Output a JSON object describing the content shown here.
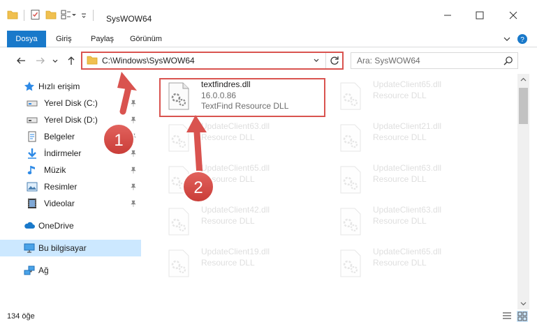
{
  "window": {
    "title": "SysWOW64"
  },
  "ribbon": {
    "tabs": [
      {
        "label": "Dosya"
      },
      {
        "label": "Giriş"
      },
      {
        "label": "Paylaş"
      },
      {
        "label": "Görünüm"
      }
    ]
  },
  "address": {
    "path": "C:\\Windows\\SysWOW64"
  },
  "search": {
    "placeholder": "Ara: SysWOW64"
  },
  "navigation": {
    "quick_access": "Hızlı erişim",
    "items": [
      {
        "label": "Yerel Disk (C:)",
        "icon": "drive-icon"
      },
      {
        "label": "Yerel Disk (D:)",
        "icon": "drive-icon"
      },
      {
        "label": "Belgeler",
        "icon": "documents-icon"
      },
      {
        "label": "İndirmeler",
        "icon": "downloads-icon"
      },
      {
        "label": "Müzik",
        "icon": "music-icon"
      },
      {
        "label": "Resimler",
        "icon": "pictures-icon"
      },
      {
        "label": "Videolar",
        "icon": "videos-icon"
      }
    ],
    "onedrive": "OneDrive",
    "this_pc": "Bu bilgisayar",
    "network": "Ağ"
  },
  "files": [
    {
      "name": "textfindres.dll",
      "version": "16.0.0.86",
      "description": "TextFind Resource DLL",
      "state": "active"
    },
    {
      "name": "UpdateClient65.dll",
      "description": "Resource DLL",
      "state": "faded"
    },
    {
      "name": "UpdateClient63.dll",
      "description": "Resource DLL",
      "state": "faded"
    },
    {
      "name": "UpdateClient21.dll",
      "description": "Resource DLL",
      "state": "faded"
    },
    {
      "name": "UpdateClient65.dll",
      "description": "Resource DLL",
      "state": "faded"
    },
    {
      "name": "UpdateClient63.dll",
      "description": "Resource DLL",
      "state": "faded"
    },
    {
      "name": "UpdateClient42.dll",
      "description": "Resource DLL",
      "state": "faded"
    },
    {
      "name": "UpdateClient63.dll",
      "description": "Resource DLL",
      "state": "faded"
    },
    {
      "name": "UpdateClient19.dll",
      "description": "Resource DLL",
      "state": "faded"
    },
    {
      "name": "UpdateClient65.dll",
      "description": "Resource DLL",
      "state": "faded"
    }
  ],
  "status": {
    "item_count": "134 öğe"
  },
  "annotations": {
    "step1": "1",
    "step2": "2"
  },
  "colors": {
    "accent": "#1979ca",
    "annotation_red": "#d9534f",
    "selection": "#cce8ff"
  }
}
